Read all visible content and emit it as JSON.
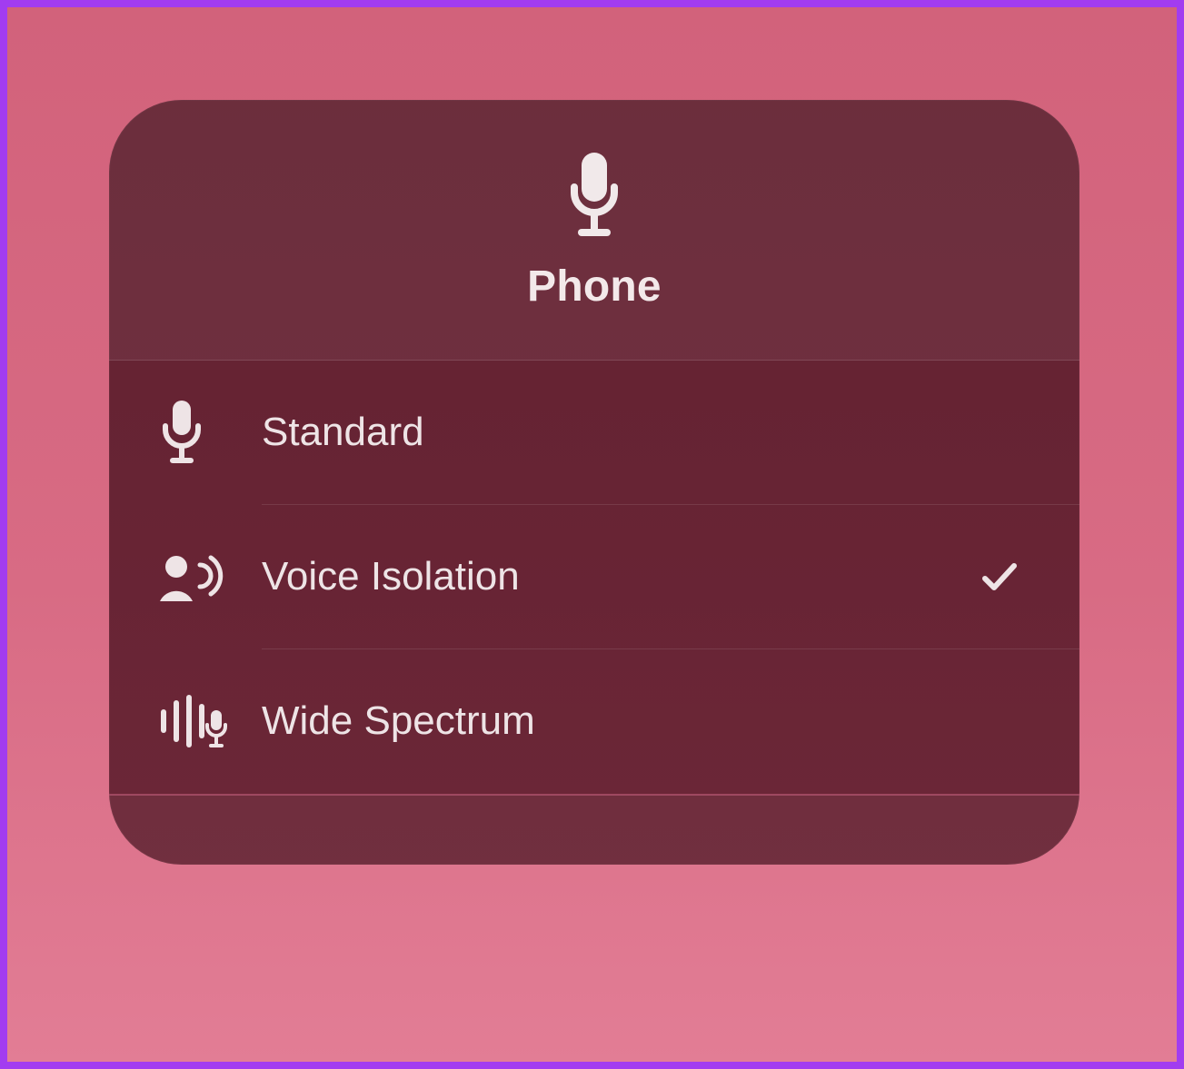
{
  "panel": {
    "title": "Phone",
    "icon": "microphone-icon",
    "options": [
      {
        "id": "standard",
        "label": "Standard",
        "icon": "microphone-icon",
        "selected": false
      },
      {
        "id": "voice-isolation",
        "label": "Voice Isolation",
        "icon": "person-speaking-icon",
        "selected": true
      },
      {
        "id": "wide-spectrum",
        "label": "Wide Spectrum",
        "icon": "audio-waveform-mic-icon",
        "selected": false
      }
    ]
  },
  "colors": {
    "frame_border": "#a23cf0",
    "bg_top": "#d2627b",
    "bg_bottom": "#e27d95",
    "panel_tint": "#5a1c2b",
    "text": "#eee4e6"
  }
}
